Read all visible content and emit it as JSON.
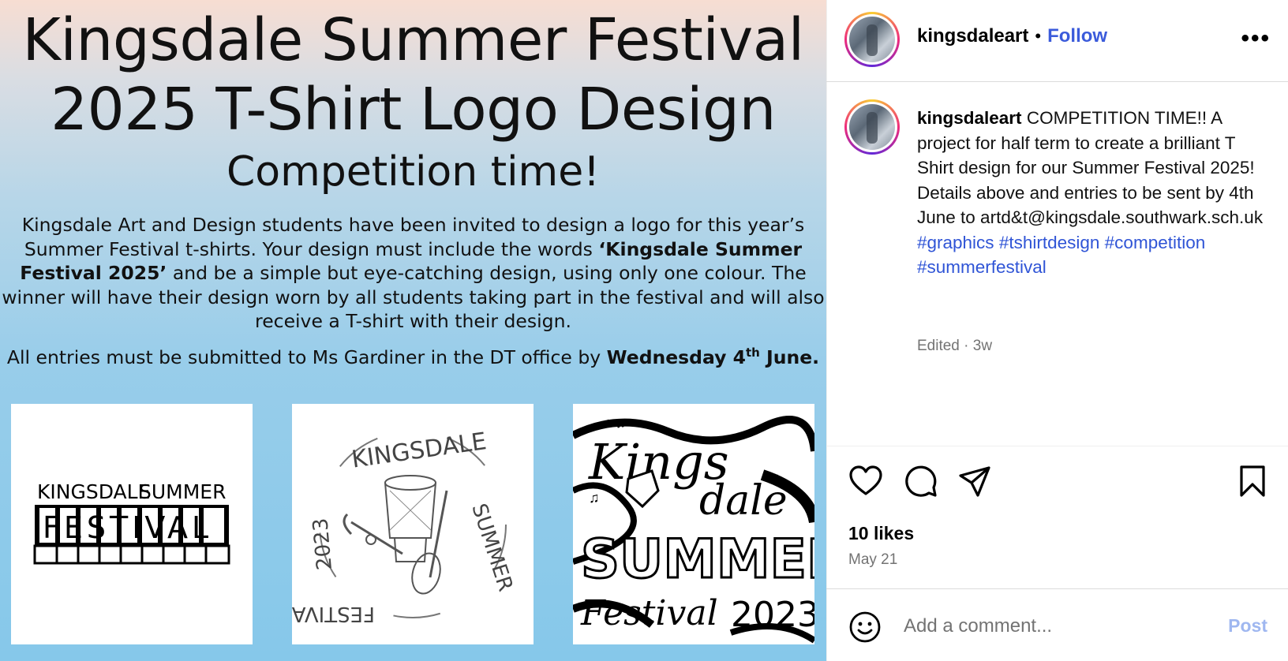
{
  "poster": {
    "title_line1": "Kingsdale Summer Festival",
    "title_line2": "2025 T-Shirt Logo Design",
    "subtitle": "Competition time!",
    "body_line1": "Kingsdale Art and Design students have been invited to design a logo for this year’s",
    "body_line2_a": "Summer Festival t-shirts. Your design must include the words ",
    "body_line2_b": "‘Kingsdale Summer",
    "body_line3_a": "Festival 2025’",
    "body_line3_b": " and be a simple but eye-catching design, using only one colour.  The",
    "body_line4": "winner will have their design worn by all students taking part in the festival and will also",
    "body_line5": "receive a T-shirt with their design.",
    "deadline_a": "All entries must be submitted to Ms Gardiner in the DT office by ",
    "deadline_b": "Wednesday 4",
    "deadline_sup": "th",
    "deadline_c": " June.",
    "examples": [
      {
        "top": "KINGSDALE",
        "top2": "SUMMER",
        "bottom": "FESTIVAL"
      },
      {
        "arc_top": "KINGSDALE",
        "arc_right": "SUMMER",
        "arc_left": "2023",
        "arc_bottom": "FESTIVAL"
      },
      {
        "line1": "Kings",
        "line2": "dale",
        "line3": "SUMMER",
        "line4": "Festival",
        "line5": "2023"
      }
    ]
  },
  "header": {
    "username": "kingsdaleart",
    "separator": "•",
    "follow_label": "Follow",
    "more_label": "•••"
  },
  "caption": {
    "username": "kingsdaleart",
    "text": "COMPETITION TIME!! A project for half term to create a brilliant T Shirt design for our Summer Festival 2025! Details above and entries to be sent by 4th June to artd&t@kingsdale.southwark.sch.uk",
    "hashtags": [
      "#graphics",
      "#tshirtdesign",
      "#competition",
      "#summerfestival"
    ],
    "meta": "Edited · 3w"
  },
  "engagement": {
    "likes": "10 likes",
    "date": "May 21"
  },
  "comment": {
    "placeholder": "Add a comment...",
    "post_label": "Post"
  },
  "colors": {
    "follow": "#3b5bdb",
    "hashtag": "#2f54d6",
    "post_disabled": "#9fb7f0",
    "muted": "#737373"
  },
  "icons": [
    "heart-icon",
    "comment-icon",
    "share-icon",
    "bookmark-icon",
    "emoji-icon",
    "more-icon"
  ]
}
